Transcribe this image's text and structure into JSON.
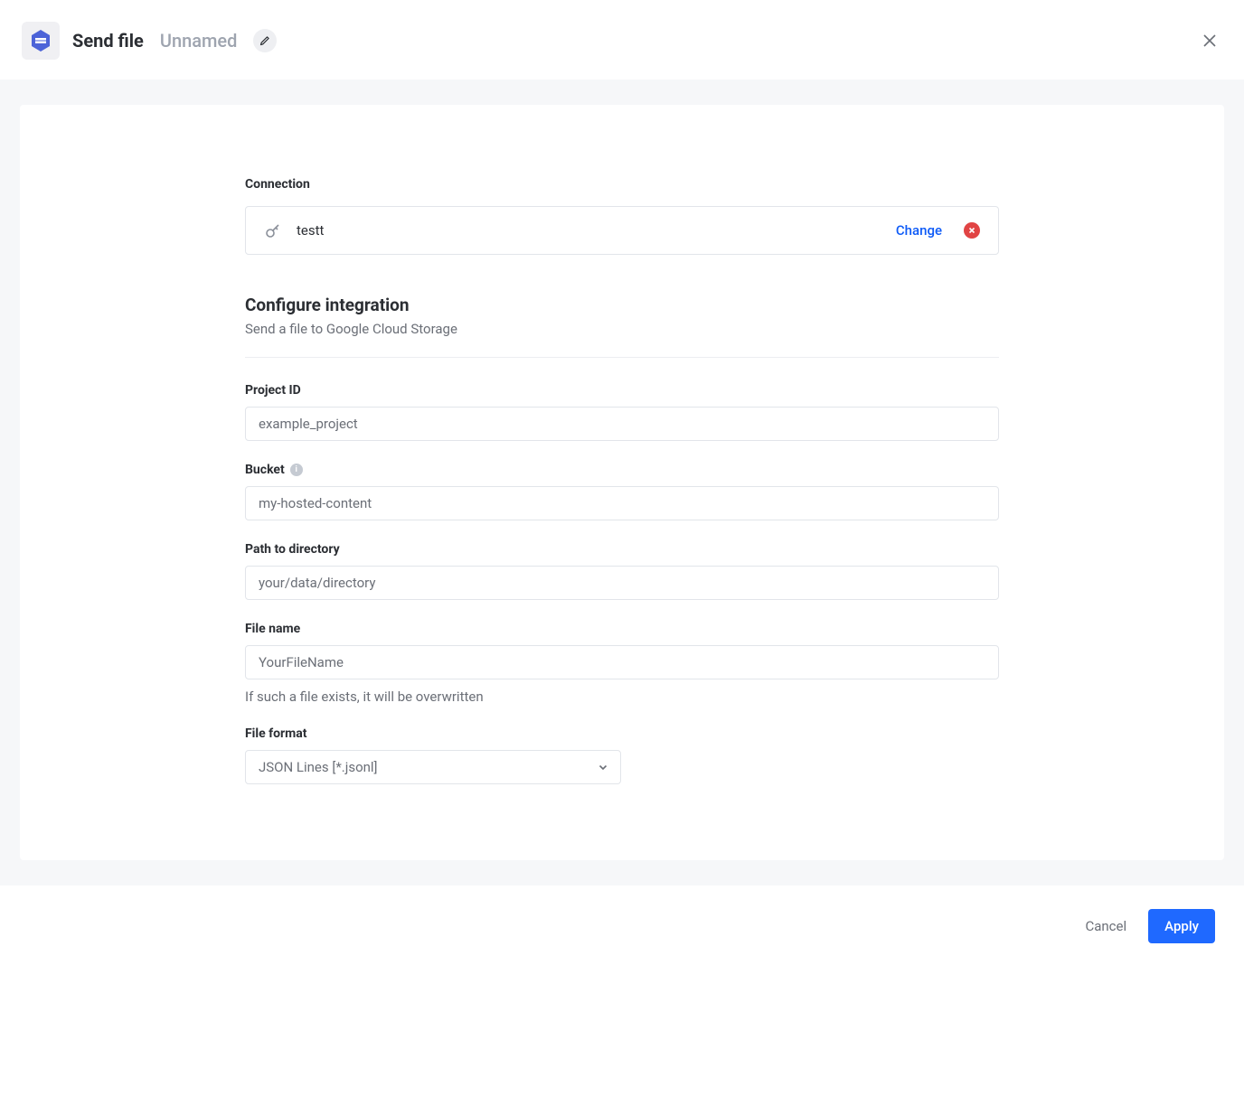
{
  "header": {
    "title": "Send file",
    "subtitle": "Unnamed"
  },
  "connection": {
    "label": "Connection",
    "name": "testt",
    "change_label": "Change"
  },
  "configure": {
    "title": "Configure integration",
    "description": "Send a file to Google Cloud Storage"
  },
  "fields": {
    "project_id": {
      "label": "Project ID",
      "placeholder": "example_project",
      "value": ""
    },
    "bucket": {
      "label": "Bucket",
      "placeholder": "my-hosted-content",
      "value": ""
    },
    "path": {
      "label": "Path to directory",
      "placeholder": "your/data/directory",
      "value": ""
    },
    "filename": {
      "label": "File name",
      "placeholder": "YourFileName",
      "value": "",
      "hint": "If such a file exists, it will be overwritten"
    },
    "format": {
      "label": "File format",
      "selected": "JSON Lines [*.jsonl]"
    }
  },
  "footer": {
    "cancel_label": "Cancel",
    "apply_label": "Apply"
  }
}
